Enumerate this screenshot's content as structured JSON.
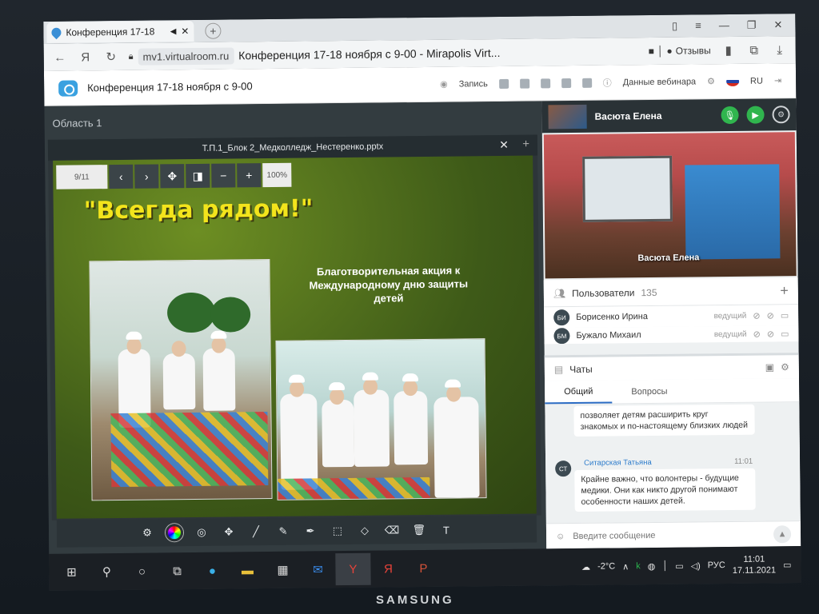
{
  "browser": {
    "tab_title": "Конференция 17-18",
    "url_domain": "mv1.virtualroom.ru",
    "page_title": "Конференция 17-18 ноября с 9-00 - Mirapolis Virt...",
    "reviews_label": "Отзывы"
  },
  "app": {
    "title": "Конференция 17-18 ноября с 9-00",
    "record_label": "Запись",
    "webinar_data_label": "Данные вебинара",
    "language": "RU"
  },
  "area": {
    "label": "Область 1"
  },
  "viewer": {
    "filename": "Т.П.1_Блок 2_Медколледж_Нестеренко.pptx",
    "page_indicator": "9/11",
    "zoom": "100%"
  },
  "slide": {
    "heading": "\"Всегда рядом!\"",
    "subtitle": "Благотворительная акция к Международному дню защиты детей"
  },
  "video": {
    "speaker_name": "Васюта Елена"
  },
  "users": {
    "label": "Пользователи",
    "count": "135",
    "rows": [
      {
        "initials": "БИ",
        "name": "Борисенко Ирина",
        "role": "ведущий"
      },
      {
        "initials": "БМ",
        "name": "Бужало Михаил",
        "role": "ведущий"
      }
    ]
  },
  "chats": {
    "label": "Чаты",
    "tab_general": "Общий",
    "tab_questions": "Вопросы",
    "messages": [
      {
        "author": "",
        "time": "",
        "text": "позволяет детям расширить круг знакомых и по-настоящему близких людей"
      },
      {
        "author": "Ситарская Татьяна",
        "initials": "СТ",
        "time": "11:01",
        "text": "Крайне важно, что волонтеры - будущие медики. Они как никто другой понимают особенности наших детей."
      }
    ],
    "input_placeholder": "Введите сообщение"
  },
  "taskbar": {
    "weather": "-2°C",
    "language": "РУС",
    "time": "11:01",
    "date": "17.11.2021"
  },
  "monitor": {
    "brand": "SAMSUNG"
  },
  "colors": {
    "accent": "#2b6cc4",
    "green_button": "#30b54e",
    "slide_heading": "#f3e41c"
  }
}
